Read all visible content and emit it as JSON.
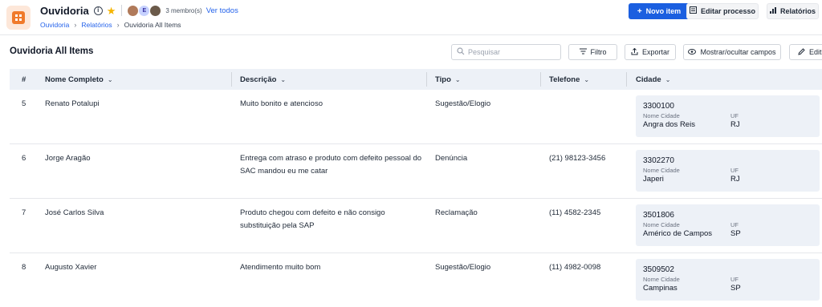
{
  "header": {
    "title": "Ouvidoria",
    "members_text": "3 membro(s)",
    "see_all": "Ver todos",
    "avatar_letter": "E",
    "breadcrumb": [
      "Ouvidoria",
      "Relatórios",
      "Ouvidoria All Items"
    ],
    "buttons": {
      "new_item": "Novo item",
      "edit_process": "Editar processo",
      "reports": "Relatórios"
    }
  },
  "toolbar": {
    "view_title": "Ouvidoria All Items",
    "search_placeholder": "Pesquisar",
    "filter": "Filtro",
    "export": "Exportar",
    "show_hide": "Mostrar/ocultar campos",
    "edit": "Edit"
  },
  "table": {
    "columns": [
      "#",
      "Nome Completo",
      "Descrição",
      "Tipo",
      "Telefone",
      "Cidade"
    ],
    "city_labels": {
      "name": "Nome Cidade",
      "uf": "UF"
    },
    "rows": [
      {
        "num": "5",
        "name": "Renato Potalupi",
        "description": "Muito bonito e atencioso",
        "type": "Sugestão/Elogio",
        "phone": "",
        "city": {
          "code": "3300100",
          "name": "Angra dos Reis",
          "uf": "RJ"
        }
      },
      {
        "num": "6",
        "name": "Jorge Aragão",
        "description": "Entrega com atraso e produto com defeito pessoal do SAC mandou eu me catar",
        "type": "Denúncia",
        "phone": "(21) 98123-3456",
        "city": {
          "code": "3302270",
          "name": "Japeri",
          "uf": "RJ"
        }
      },
      {
        "num": "7",
        "name": "José Carlos Silva",
        "description": "Produto chegou com defeito e não consigo substituição pela SAP",
        "type": "Reclamação",
        "phone": "(11) 4582-2345",
        "city": {
          "code": "3501806",
          "name": "Américo de Campos",
          "uf": "SP"
        }
      },
      {
        "num": "8",
        "name": "Augusto Xavier",
        "description": "Atendimento muito bom",
        "type": "Sugestão/Elogio",
        "phone": "(11) 4982-0098",
        "city": {
          "code": "3509502",
          "name": "Campinas",
          "uf": "SP"
        }
      }
    ]
  },
  "colors": {
    "primary": "#1b5fe0",
    "link": "#2563eb",
    "header_bg": "#edf1f7",
    "logo_accent": "#f07a2b",
    "star": "#f5b400"
  }
}
